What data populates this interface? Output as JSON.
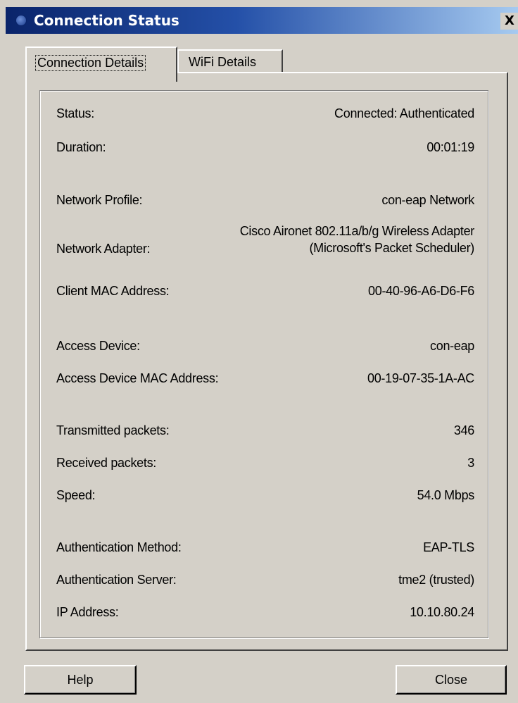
{
  "window": {
    "title": "Connection Status",
    "close_glyph": "X"
  },
  "tabs": [
    {
      "label": "Connection Details",
      "active": true
    },
    {
      "label": "WiFi Details",
      "active": false
    }
  ],
  "details": {
    "status": {
      "label": "Status:",
      "value": "Connected: Authenticated"
    },
    "duration": {
      "label": "Duration:",
      "value": "00:01:19"
    },
    "network_profile": {
      "label": "Network Profile:",
      "value": "con-eap Network"
    },
    "network_adapter": {
      "label": "Network Adapter:",
      "value": "Cisco Aironet 802.11a/b/g Wireless Adapter (Microsoft's Packet Scheduler)"
    },
    "client_mac": {
      "label": "Client MAC Address:",
      "value": "00-40-96-A6-D6-F6"
    },
    "access_device": {
      "label": "Access Device:",
      "value": "con-eap"
    },
    "access_device_mac": {
      "label": "Access Device MAC Address:",
      "value": "00-19-07-35-1A-AC"
    },
    "tx_packets": {
      "label": "Transmitted packets:",
      "value": "346"
    },
    "rx_packets": {
      "label": "Received packets:",
      "value": "3"
    },
    "speed": {
      "label": "Speed:",
      "value": "54.0 Mbps"
    },
    "auth_method": {
      "label": "Authentication Method:",
      "value": "EAP-TLS"
    },
    "auth_server": {
      "label": "Authentication Server:",
      "value": "tme2 (trusted)"
    },
    "ip_address": {
      "label": "IP Address:",
      "value": "10.10.80.24"
    }
  },
  "buttons": {
    "help": "Help",
    "close": "Close"
  },
  "colors": {
    "titlebar_start": "#0a246a",
    "titlebar_end": "#a6caf0",
    "face": "#d4d0c8"
  }
}
